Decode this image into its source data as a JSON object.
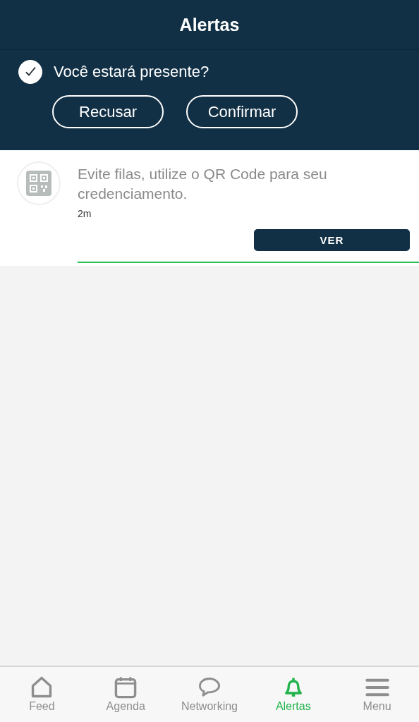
{
  "header": {
    "title": "Alertas"
  },
  "attendance": {
    "question": "Você estará presente?",
    "checked": true,
    "buttons": [
      "Recusar",
      "Confirmar"
    ]
  },
  "notifications": [
    {
      "message": "Evite filas, utilize o QR Code para seu credenciamento.",
      "time": "2m",
      "action": "VER",
      "unread": true
    }
  ],
  "tab_bar": [
    {
      "label": "Feed",
      "kind": "home",
      "selected": false
    },
    {
      "label": "Agenda",
      "kind": "calendar",
      "selected": false
    },
    {
      "label": "Networking",
      "kind": "chat",
      "selected": false
    },
    {
      "label": "Alertas",
      "kind": "bell",
      "selected": true
    },
    {
      "label": "Menu",
      "kind": "menu",
      "selected": false
    }
  ]
}
